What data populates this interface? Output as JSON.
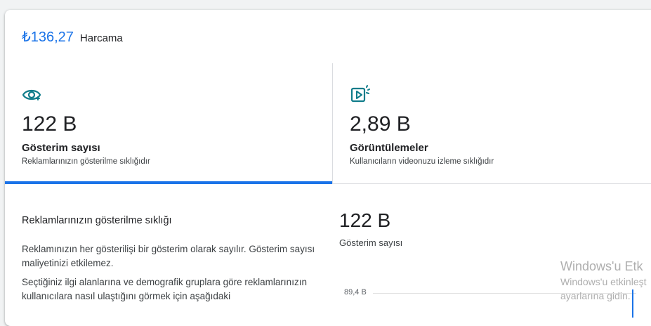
{
  "spend": {
    "amount": "₺136,27",
    "label": "Harcama"
  },
  "metrics": [
    {
      "icon": "eye-icon",
      "value": "122 B",
      "title": "Gösterim sayısı",
      "description": "Reklamlarınızın gösterilme sıklığıdır",
      "selected": true
    },
    {
      "icon": "video-play-icon",
      "value": "2,89 B",
      "title": "Görüntülemeler",
      "description": "Kullanıcıların videonuzu izleme sıklığıdır",
      "selected": false
    }
  ],
  "detail": {
    "title": "Reklamlarınızın gösterilme sıklığı",
    "paragraph1": "Reklamınızın her gösterilişi bir gösterim olarak sayılır. Gösterim sayısı maliyetinizi etkilemez.",
    "paragraph2": "Seçtiğiniz ilgi alanlarına ve demografik gruplara göre reklamlarınızın kullanıcılara nasıl ulaştığını görmek için aşağıdaki"
  },
  "chart": {
    "value": "122 B",
    "label": "Gösterim sayısı",
    "tick_label": "89,4 B"
  },
  "colors": {
    "accent": "#1a73e8",
    "icon_teal": "#0f7c8a",
    "text": "#202124",
    "muted": "#3c4043"
  },
  "watermark": {
    "line1": "Windows'u Etk",
    "line2": "Windows'u etkinleşt",
    "line3": "ayarlarına gidin."
  }
}
